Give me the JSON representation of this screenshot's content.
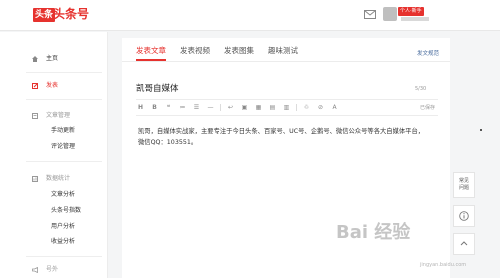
{
  "header": {
    "logo_badge": "头条",
    "logo_text": "头条号",
    "user_badge": "个人·新手"
  },
  "sidebar": {
    "home": "主页",
    "publish": "发表",
    "article_manage": "文章管理",
    "manual_update": "手动更新",
    "comment_manage": "评论管理",
    "data_stats": "数据统计",
    "article_analysis": "文章分析",
    "toutiao_index": "头条号指数",
    "user_analysis": "用户分析",
    "revenue_analysis": "收益分析",
    "more": "号外"
  },
  "tabs": [
    {
      "label": "发表文章",
      "active": true
    },
    {
      "label": "发表视频",
      "active": false
    },
    {
      "label": "发表图集",
      "active": false
    },
    {
      "label": "趣味测试",
      "active": false
    }
  ],
  "guide_link": "发文规范",
  "editor": {
    "title_value": "凯哥自媒体",
    "title_count": "5/30",
    "save_status": "已保存",
    "toolbar": [
      "H",
      "B",
      "❝",
      "≔",
      "☰",
      "—",
      "↩",
      "▣",
      "▦",
      "▤",
      "▥",
      "♲",
      "⊘",
      "A"
    ],
    "body_line1": "凯哥，自媒体实战家，主要专注于今日头条、百家号、UC号、企鹅号、微信公众号等各大自媒体平台，",
    "body_line2": "微信QQ：103551。"
  },
  "floating": {
    "faq": "常见问题",
    "info_icon": "info-icon",
    "top_icon": "back-to-top-icon"
  },
  "watermark": {
    "logo": "Bai 经验",
    "sub": "经验",
    "url": "jingyan.baidu.com"
  },
  "colors": {
    "accent": "#e6322e",
    "link": "#406599"
  }
}
